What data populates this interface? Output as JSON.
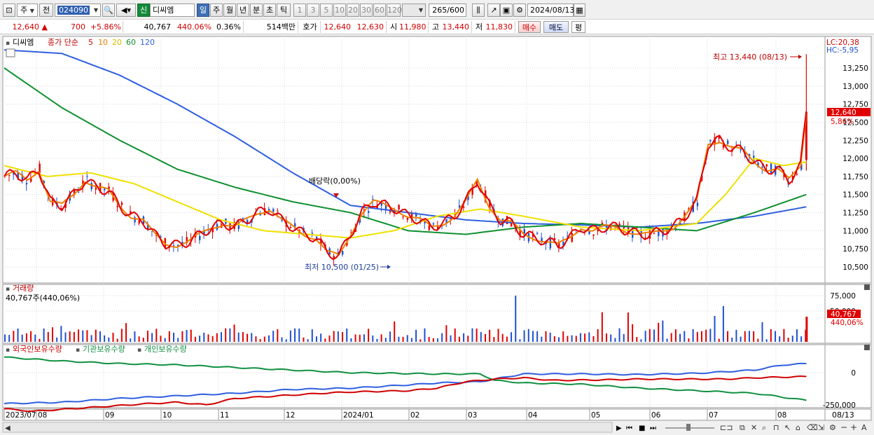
{
  "toolbar": {
    "type_select": "주",
    "prefix_btn": "전",
    "code": "024090",
    "name_badge": "신",
    "stock_name": "디씨엠",
    "period_tabs": [
      "일",
      "주",
      "월",
      "년",
      "분",
      "초",
      "틱"
    ],
    "period_active": "일",
    "intervals": [
      "1",
      "3",
      "5",
      "10",
      "20",
      "30",
      "60",
      "120"
    ],
    "count": "265",
    "count_max": "/600",
    "date": "2024/08/13"
  },
  "quote": {
    "price": "12,640",
    "change_arrow": "▲",
    "change": "700",
    "change_pct": "+5.86%",
    "volume": "40,767",
    "volume_pct": "440.06%",
    "turnover_pct": "0.36%",
    "amount": "514백만",
    "bidask_label": "호가",
    "ask": "12,640",
    "bid": "12,630",
    "open_label": "시",
    "open": "11,980",
    "high_label": "고",
    "high": "13,440",
    "low_label": "저",
    "low": "11,830",
    "buy_label": "매수",
    "sell_label": "매도",
    "avg_label": "평"
  },
  "price_pane": {
    "legend_name": "디씨엠",
    "legend_title": "종가 단순",
    "ma_periods": [
      "5",
      "10",
      "20",
      "60",
      "120"
    ],
    "lc_label": "LC:20,38",
    "hc_label": "HC:-5,95",
    "last_price_tag": "12,640",
    "last_pct_tag": "5,86%",
    "high_annotation": "최고 13,440 (08/13)",
    "low_annotation": "최저 10,500 (01/25)",
    "dividend_annotation": "배당락(0,00%)",
    "y_ticks": [
      "13,250",
      "13,000",
      "12,750",
      "12,500",
      "12,250",
      "12,000",
      "11,750",
      "11,500",
      "11,250",
      "11,000",
      "10,750",
      "10,500"
    ]
  },
  "volume_pane": {
    "title": "거래량",
    "last_label": "40,767주(440,06%)",
    "y_ticks": [
      "75,000",
      "50,000"
    ],
    "last_tag": "40,767",
    "last_pct_tag": "440,06%"
  },
  "holdings_pane": {
    "legend": [
      "외국인보유수량",
      "기관보유수량",
      "개인보유수량"
    ],
    "y_ticks": [
      "0",
      "-250,000"
    ]
  },
  "x_axis": {
    "labels": [
      "2023/07",
      "08",
      "09",
      "10",
      "11",
      "12",
      "2024/01",
      "02",
      "03",
      "04",
      "05",
      "06",
      "07",
      "08"
    ],
    "right_label": "08/13"
  },
  "colors": {
    "up": "#e00000",
    "down": "#1f4fd0",
    "ma5": "#e00000",
    "ma10": "#f08000",
    "ma20": "#f0e000",
    "ma60": "#109030",
    "ma120": "#2f5fe0",
    "foreign": "#d00000",
    "institution": "#109040",
    "individual": "#2f5fe0"
  },
  "chart_data": {
    "type": "candlestick",
    "ylim": [
      10400,
      13440
    ],
    "moving_average": {
      "ma5": [
        [
          0,
          11750
        ],
        [
          8,
          11800
        ],
        [
          16,
          11700
        ],
        [
          24,
          11850
        ],
        [
          32,
          11400
        ],
        [
          40,
          11350
        ],
        [
          48,
          11500
        ],
        [
          56,
          11700
        ],
        [
          64,
          11600
        ],
        [
          72,
          11550
        ],
        [
          80,
          11350
        ],
        [
          88,
          11200
        ],
        [
          96,
          11150
        ],
        [
          104,
          10950
        ],
        [
          112,
          10820
        ],
        [
          120,
          10800
        ],
        [
          128,
          10850
        ],
        [
          136,
          10950
        ],
        [
          144,
          11050
        ],
        [
          152,
          11100
        ],
        [
          160,
          11050
        ],
        [
          168,
          11150
        ],
        [
          176,
          11250
        ],
        [
          184,
          11300
        ],
        [
          192,
          11150
        ],
        [
          200,
          11050
        ],
        [
          208,
          10950
        ],
        [
          216,
          10900
        ],
        [
          224,
          10700
        ],
        [
          232,
          10650
        ],
        [
          240,
          10950
        ],
        [
          248,
          11250
        ],
        [
          256,
          11400
        ],
        [
          264,
          11350
        ],
        [
          272,
          11300
        ],
        [
          280,
          11200
        ],
        [
          288,
          11150
        ],
        [
          296,
          11050
        ],
        [
          304,
          11100
        ],
        [
          312,
          11200
        ],
        [
          320,
          11400
        ],
        [
          328,
          11700
        ],
        [
          336,
          11350
        ],
        [
          344,
          11150
        ],
        [
          352,
          11100
        ],
        [
          360,
          10950
        ],
        [
          368,
          10900
        ],
        [
          376,
          10850
        ],
        [
          384,
          10800
        ],
        [
          392,
          10900
        ],
        [
          400,
          11050
        ],
        [
          408,
          11000
        ],
        [
          416,
          11050
        ],
        [
          424,
          11050
        ],
        [
          432,
          11000
        ],
        [
          440,
          10950
        ],
        [
          448,
          10950
        ],
        [
          456,
          11000
        ],
        [
          464,
          11050
        ],
        [
          472,
          11200
        ],
        [
          480,
          11400
        ],
        [
          488,
          12200
        ],
        [
          496,
          12250
        ],
        [
          504,
          12150
        ],
        [
          512,
          12100
        ],
        [
          520,
          11950
        ],
        [
          528,
          11850
        ],
        [
          536,
          11850
        ],
        [
          544,
          11700
        ],
        [
          552,
          11900
        ],
        [
          556,
          12640
        ]
      ],
      "ma120": [
        [
          0,
          13500
        ],
        [
          40,
          13450
        ],
        [
          80,
          13150
        ],
        [
          120,
          12750
        ],
        [
          160,
          12300
        ],
        [
          200,
          11800
        ],
        [
          240,
          11350
        ],
        [
          280,
          11250
        ],
        [
          320,
          11150
        ],
        [
          360,
          11100
        ],
        [
          400,
          11080
        ],
        [
          440,
          11050
        ],
        [
          480,
          11100
        ],
        [
          520,
          11200
        ],
        [
          556,
          11330
        ]
      ]
    },
    "volume_peak": 75000
  }
}
